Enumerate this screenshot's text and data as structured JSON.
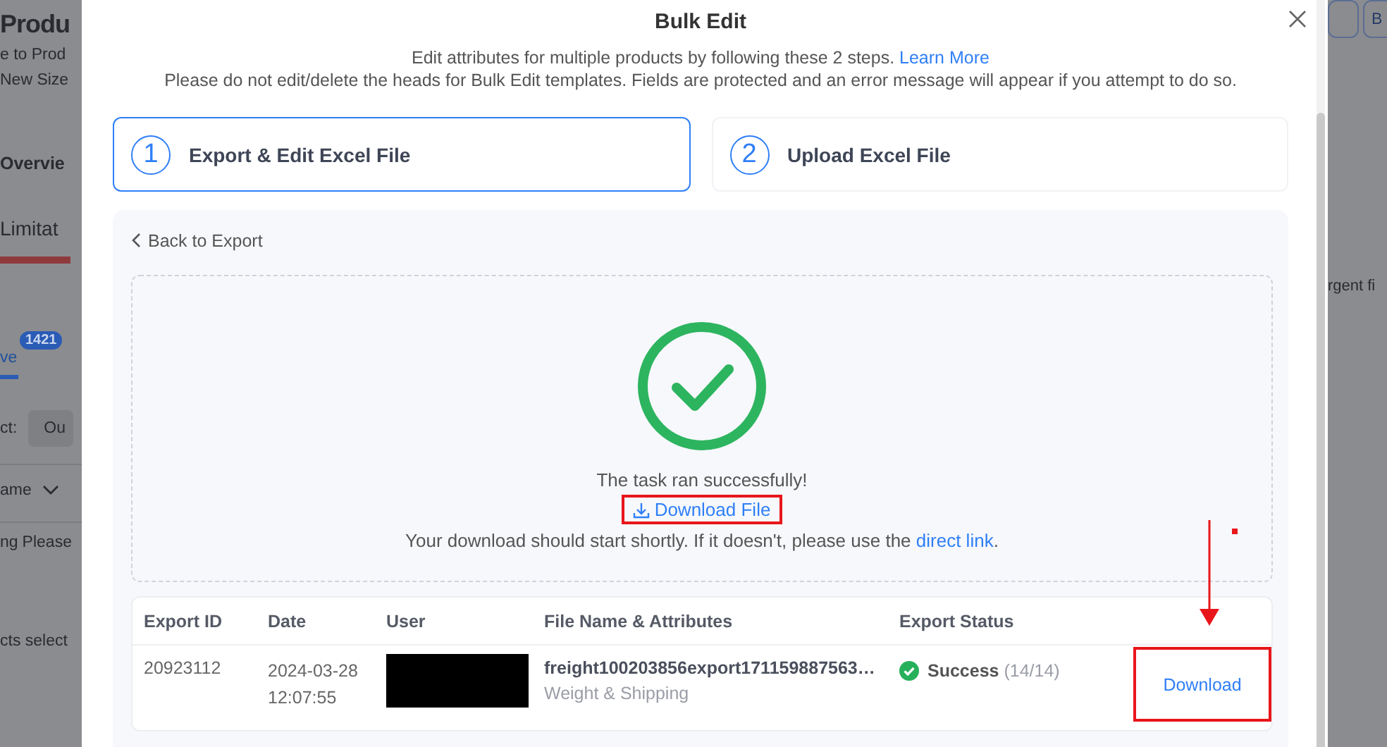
{
  "background": {
    "left": [
      {
        "kind": "heading",
        "text": "Produ"
      },
      {
        "kind": "text",
        "text": "e to Prod"
      },
      {
        "kind": "text",
        "text": "New Size"
      },
      {
        "kind": "section",
        "text": "Overvie"
      },
      {
        "kind": "tab",
        "text": "Limitat"
      },
      {
        "kind": "badge",
        "text": "1421"
      },
      {
        "kind": "active-tab",
        "text": "ve"
      },
      {
        "kind": "select",
        "text": "ct:",
        "value": "Ou"
      },
      {
        "kind": "sort",
        "text": "ame"
      },
      {
        "kind": "filter",
        "text": "ng",
        "value": "Please"
      },
      {
        "kind": "text",
        "text": "cts select"
      }
    ],
    "right": [
      {
        "kind": "buttons",
        "text": "B"
      },
      {
        "kind": "text",
        "text": "rgent fi"
      }
    ]
  },
  "modal": {
    "title": "Bulk Edit",
    "intro": "Edit attributes for multiple products by following these 2 steps.",
    "learn_more": "Learn More",
    "warning": "Please do not edit/delete the heads for Bulk Edit templates. Fields are protected and an error message will appear if you attempt to do so.",
    "steps": [
      {
        "number": "1",
        "label": "Export & Edit Excel File",
        "selected": true
      },
      {
        "number": "2",
        "label": "Upload Excel File",
        "selected": false
      }
    ],
    "back_link": "Back to Export",
    "result": {
      "kind": "success",
      "message": "The task ran successfully!",
      "download_link": "Download File",
      "download_highlighted": true,
      "hint": "Your download should start shortly. If it doesn't, please use the",
      "hint_link": "direct link",
      "hint_end": "."
    },
    "export_table": {
      "columns": [
        "Export ID",
        "Date",
        "User",
        "File Name & Attributes",
        "Export Status"
      ],
      "rows": [
        {
          "export_id": "20923112",
          "date": "2024-03-28 12:07:55",
          "user_redacted": true,
          "file_name": "freight100203856export171159887563…",
          "attributes": "Weight & Shipping",
          "kind": "success",
          "status_label": "Success",
          "status_count": "(14/14)",
          "action": "Download",
          "action_highlighted": true
        }
      ]
    }
  }
}
